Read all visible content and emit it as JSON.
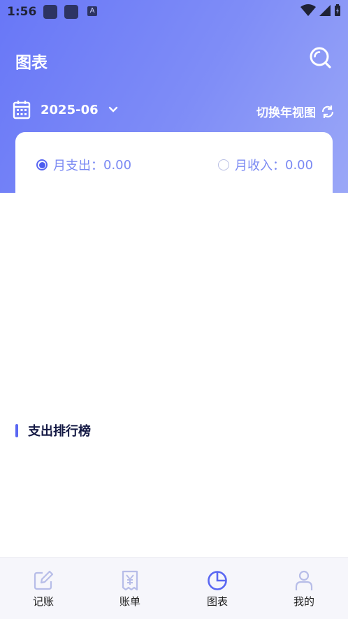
{
  "status_bar": {
    "time": "1:56",
    "a_icon": "A"
  },
  "header": {
    "title": "图表",
    "search_icon": "search-icon"
  },
  "month_selector": {
    "value": "2025-06",
    "calendar_icon": "calendar-icon",
    "chevron_icon": "chevron-down-icon"
  },
  "view_switch": {
    "label": "切换年视图",
    "icon": "refresh-icon"
  },
  "summary": {
    "expense": {
      "label": "月支出：",
      "value": "0.00",
      "selected": true
    },
    "income": {
      "label": "月收入：",
      "value": "0.00",
      "selected": false
    }
  },
  "ranking": {
    "title": "支出排行榜"
  },
  "tabs": [
    {
      "label": "记账",
      "icon": "edit-icon",
      "active": false
    },
    {
      "label": "账单",
      "icon": "receipt-icon",
      "active": false
    },
    {
      "label": "图表",
      "icon": "pie-chart-icon",
      "active": true
    },
    {
      "label": "我的",
      "icon": "user-icon",
      "active": false
    }
  ],
  "colors": {
    "accent": "#5a67f2",
    "header_gradient_start": "#6877f7",
    "header_gradient_end": "#9aa7f7",
    "inactive_icon": "#b7bde8"
  }
}
